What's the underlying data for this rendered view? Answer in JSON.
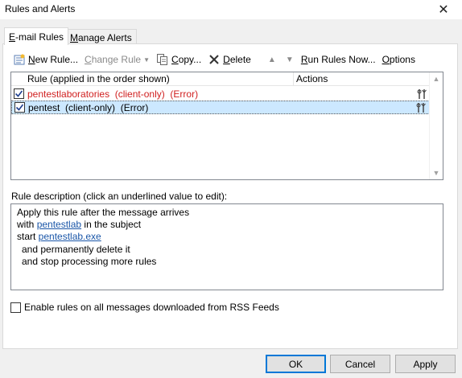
{
  "window": {
    "title": "Rules and Alerts",
    "close_glyph": "✕"
  },
  "tabs": [
    {
      "label": "E-mail Rules",
      "active": true
    },
    {
      "label": "Manage Alerts",
      "active": false
    }
  ],
  "toolbar": {
    "new_rule": "New Rule...",
    "change_rule": "Change Rule",
    "copy": "Copy...",
    "delete": "Delete",
    "run_rules_now": "Run Rules Now...",
    "options": "Options"
  },
  "rules_list": {
    "columns": [
      "Rule (applied in the order shown)",
      "Actions"
    ],
    "rows": [
      {
        "name": "pentestlaboratories  (client-only)  (Error)",
        "checked": true,
        "error": true,
        "selected": false
      },
      {
        "name": "pentest  (client-only)  (Error)",
        "checked": true,
        "error": false,
        "selected": true
      }
    ]
  },
  "description": {
    "label": "Rule description (click an underlined value to edit):",
    "line1": "Apply this rule after the message arrives",
    "line2_prefix": "with ",
    "line2_link": "pentestlab",
    "line2_suffix": " in the subject",
    "line3_prefix": "start ",
    "line3_link": "pentestlab.exe",
    "line4": "and permanently delete it",
    "line5": "and stop processing more rules"
  },
  "rss": {
    "label": "Enable rules on all messages downloaded from RSS Feeds",
    "checked": false
  },
  "buttons": {
    "ok": "OK",
    "cancel": "Cancel",
    "apply": "Apply"
  },
  "colors": {
    "error_text": "#d01f1f",
    "selection": "#cce8ff",
    "link": "#1a56a8",
    "default_button_border": "#0078d7"
  }
}
